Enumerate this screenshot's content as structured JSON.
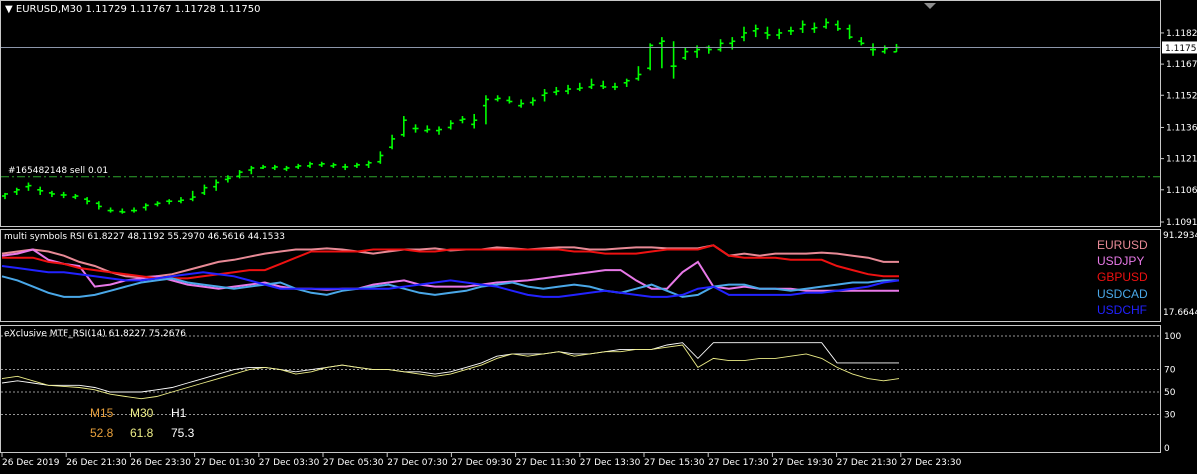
{
  "main_chart": {
    "header": "EURUSD,M30  1.11729 1.11767 1.11728 1.11750",
    "order_label": "#165482148 sell 0.01",
    "current_price": "1.11750",
    "price_ticks": [
      "1.11820",
      "1.11670",
      "1.11520",
      "1.11365",
      "1.11215",
      "1.11065",
      "1.10910"
    ],
    "price_range": [
      1.1091,
      1.1194
    ],
    "order_price": 1.11128,
    "bar_color": "#00ff00",
    "order_line_color": "#2ea52e",
    "bars": [
      [
        1.11035,
        1.1105,
        1.1102,
        1.11045
      ],
      [
        1.11055,
        1.11075,
        1.1104,
        1.11065
      ],
      [
        1.1108,
        1.111,
        1.1106,
        1.11085
      ],
      [
        1.11065,
        1.1108,
        1.1104,
        1.1106
      ],
      [
        1.1105,
        1.1106,
        1.1103,
        1.11045
      ],
      [
        1.1104,
        1.11055,
        1.11025,
        1.1104
      ],
      [
        1.1103,
        1.11045,
        1.1102,
        1.11035
      ],
      [
        1.1102,
        1.1103,
        1.10995,
        1.1101
      ],
      [
        1.11,
        1.1101,
        1.1097,
        1.10985
      ],
      [
        1.10965,
        1.1098,
        1.10955,
        1.10965
      ],
      [
        1.1096,
        1.10975,
        1.1095,
        1.10958
      ],
      [
        1.10965,
        1.1098,
        1.10955,
        1.10965
      ],
      [
        1.1098,
        1.11,
        1.10965,
        1.1099
      ],
      [
        1.10995,
        1.1101,
        1.10985,
        1.11
      ],
      [
        1.1101,
        1.1102,
        1.10995,
        1.1101
      ],
      [
        1.1101,
        1.1103,
        1.11,
        1.11015
      ],
      [
        1.1102,
        1.1106,
        1.1101,
        1.1103
      ],
      [
        1.1105,
        1.1109,
        1.1104,
        1.11075
      ],
      [
        1.1108,
        1.11115,
        1.1106,
        1.111
      ],
      [
        1.11115,
        1.11135,
        1.111,
        1.1112
      ],
      [
        1.1113,
        1.1116,
        1.1112,
        1.1115
      ],
      [
        1.1116,
        1.1118,
        1.1114,
        1.1117
      ],
      [
        1.1117,
        1.11185,
        1.11165,
        1.11175
      ],
      [
        1.1117,
        1.11185,
        1.1116,
        1.11175
      ],
      [
        1.11165,
        1.1118,
        1.11155,
        1.1117
      ],
      [
        1.11175,
        1.1119,
        1.11165,
        1.1118
      ],
      [
        1.1118,
        1.112,
        1.1117,
        1.1119
      ],
      [
        1.11185,
        1.112,
        1.11175,
        1.1119
      ],
      [
        1.1118,
        1.11195,
        1.1117,
        1.11185
      ],
      [
        1.11175,
        1.1119,
        1.1116,
        1.11175
      ],
      [
        1.1118,
        1.11195,
        1.1117,
        1.11185
      ],
      [
        1.11185,
        1.11205,
        1.1117,
        1.11195
      ],
      [
        1.112,
        1.1125,
        1.1119,
        1.1123
      ],
      [
        1.1127,
        1.1133,
        1.1126,
        1.1131
      ],
      [
        1.1133,
        1.1142,
        1.1132,
        1.114
      ],
      [
        1.1136,
        1.1138,
        1.1134,
        1.1136
      ],
      [
        1.1135,
        1.11375,
        1.1134,
        1.11355
      ],
      [
        1.1135,
        1.1137,
        1.1133,
        1.11355
      ],
      [
        1.11365,
        1.114,
        1.11355,
        1.11385
      ],
      [
        1.114,
        1.1142,
        1.11385,
        1.11405
      ],
      [
        1.1138,
        1.1143,
        1.1136,
        1.114
      ],
      [
        1.1147,
        1.1152,
        1.1138,
        1.115
      ],
      [
        1.115,
        1.1152,
        1.1149,
        1.11505
      ],
      [
        1.11495,
        1.11515,
        1.1148,
        1.1149
      ],
      [
        1.1147,
        1.115,
        1.1146,
        1.1148
      ],
      [
        1.11485,
        1.1151,
        1.1147,
        1.11495
      ],
      [
        1.1152,
        1.1155,
        1.1149,
        1.1153
      ],
      [
        1.11535,
        1.1156,
        1.1152,
        1.1154
      ],
      [
        1.1154,
        1.1157,
        1.11525,
        1.1155
      ],
      [
        1.1155,
        1.1158,
        1.1154,
        1.11555
      ],
      [
        1.1156,
        1.116,
        1.1155,
        1.1157
      ],
      [
        1.11565,
        1.1159,
        1.1155,
        1.1156
      ],
      [
        1.1156,
        1.1158,
        1.11545,
        1.1156
      ],
      [
        1.1158,
        1.116,
        1.1156,
        1.1159
      ],
      [
        1.116,
        1.1166,
        1.1159,
        1.1162
      ],
      [
        1.1165,
        1.1177,
        1.1164,
        1.1176
      ],
      [
        1.1177,
        1.118,
        1.1165,
        1.1178
      ],
      [
        1.1166,
        1.1178,
        1.116,
        1.1166
      ],
      [
        1.117,
        1.1175,
        1.1169,
        1.1173
      ],
      [
        1.1173,
        1.1176,
        1.117,
        1.1174
      ],
      [
        1.1175,
        1.1176,
        1.1172,
        1.1174
      ],
      [
        1.1174,
        1.1179,
        1.1173,
        1.1177
      ],
      [
        1.1177,
        1.118,
        1.1174,
        1.1178
      ],
      [
        1.118,
        1.1185,
        1.1178,
        1.1182
      ],
      [
        1.1183,
        1.1186,
        1.118,
        1.1184
      ],
      [
        1.1182,
        1.1185,
        1.1179,
        1.1181
      ],
      [
        1.1181,
        1.1184,
        1.1179,
        1.1182
      ],
      [
        1.1183,
        1.1185,
        1.1181,
        1.1183
      ],
      [
        1.1184,
        1.1188,
        1.1182,
        1.1186
      ],
      [
        1.1184,
        1.1187,
        1.1182,
        1.11845
      ],
      [
        1.1185,
        1.1189,
        1.1184,
        1.1187
      ],
      [
        1.1186,
        1.1188,
        1.1183,
        1.1184
      ],
      [
        1.1184,
        1.1186,
        1.1179,
        1.118
      ],
      [
        1.1178,
        1.118,
        1.1176,
        1.1177
      ],
      [
        1.1174,
        1.1177,
        1.1171,
        1.1174
      ],
      [
        1.1173,
        1.1176,
        1.1172,
        1.11745
      ],
      [
        1.11729,
        1.11767,
        1.11728,
        1.1175
      ]
    ]
  },
  "rsi_panel": {
    "header": "multi symbols RSI 61.8227 48.1192 55.2970 46.5616 44.1533",
    "scale_max": "91.2934",
    "scale_min": "17.6644",
    "range": [
      17.6644,
      91.2934
    ],
    "series": [
      {
        "name": "EURUSD",
        "color": "#e88a96",
        "values": [
          82,
          84,
          86,
          84,
          80,
          74,
          70,
          64,
          60,
          59,
          60,
          62,
          66,
          70,
          74,
          76,
          79,
          82,
          84,
          86,
          86,
          87,
          86,
          84,
          82,
          84,
          86,
          86,
          87,
          85,
          86,
          86,
          88,
          87,
          86,
          87,
          88,
          88,
          86,
          86,
          87,
          88,
          88,
          87,
          87,
          87,
          90,
          80,
          82,
          80,
          82,
          82,
          82,
          83,
          82,
          80,
          78,
          74,
          74
        ]
      },
      {
        "name": "USDJPY",
        "color": "#e879e8",
        "values": [
          80,
          82,
          86,
          76,
          72,
          70,
          50,
          52,
          56,
          58,
          60,
          56,
          52,
          50,
          48,
          50,
          52,
          54,
          50,
          48,
          48,
          47,
          48,
          48,
          52,
          54,
          56,
          52,
          50,
          50,
          50,
          52,
          54,
          55,
          56,
          58,
          60,
          62,
          64,
          66,
          66,
          56,
          48,
          48,
          64,
          74,
          50,
          48,
          50,
          48,
          48,
          48,
          46,
          46,
          46,
          46,
          46,
          46,
          46
        ]
      },
      {
        "name": "GBPUSD",
        "color": "#ee1111",
        "values": [
          78,
          78,
          78,
          74,
          72,
          68,
          66,
          64,
          62,
          60,
          58,
          58,
          58,
          60,
          62,
          64,
          66,
          66,
          72,
          78,
          84,
          84,
          84,
          84,
          86,
          86,
          86,
          84,
          84,
          86,
          86,
          86,
          86,
          86,
          86,
          86,
          86,
          84,
          84,
          82,
          82,
          82,
          84,
          86,
          86,
          86,
          90,
          80,
          78,
          78,
          78,
          76,
          76,
          76,
          70,
          66,
          62,
          60,
          60
        ]
      },
      {
        "name": "USDCAD",
        "color": "#4aa8e8",
        "values": [
          60,
          56,
          50,
          44,
          40,
          40,
          42,
          46,
          50,
          54,
          56,
          58,
          54,
          52,
          50,
          48,
          50,
          52,
          54,
          48,
          44,
          42,
          46,
          48,
          50,
          52,
          48,
          44,
          42,
          44,
          46,
          50,
          52,
          54,
          50,
          48,
          50,
          52,
          50,
          46,
          44,
          48,
          52,
          46,
          40,
          42,
          50,
          52,
          52,
          48,
          48,
          46,
          48,
          50,
          52,
          54,
          54,
          56,
          56
        ]
      },
      {
        "name": "USDCHF",
        "color": "#2222ff",
        "values": [
          70,
          68,
          66,
          64,
          64,
          62,
          60,
          58,
          56,
          56,
          58,
          60,
          62,
          64,
          62,
          60,
          56,
          52,
          48,
          48,
          48,
          48,
          48,
          48,
          48,
          48,
          50,
          52,
          54,
          56,
          54,
          52,
          50,
          46,
          42,
          40,
          40,
          42,
          44,
          46,
          44,
          42,
          40,
          40,
          42,
          48,
          50,
          42,
          42,
          42,
          42,
          42,
          44,
          44,
          46,
          48,
          50,
          54,
          56
        ]
      }
    ]
  },
  "mtf_panel": {
    "header": "eXclusive MTF_RSI(14) 61.8227 75.2676",
    "range": [
      0,
      100
    ],
    "scale_labels": [
      "100",
      "70",
      "50",
      "30",
      "0"
    ],
    "levels": [
      100,
      70,
      50,
      30
    ],
    "level_color": "#c8c8c8",
    "tf_labels": [
      {
        "tf": "M15",
        "value": "52.8",
        "color": "#e8a03c"
      },
      {
        "tf": "M30",
        "value": "61.8",
        "color": "#eeee88"
      },
      {
        "tf": "H1",
        "value": "75.3",
        "color": "#ffffff"
      }
    ],
    "m30_values": [
      62,
      64,
      60,
      56,
      55,
      54,
      52,
      48,
      46,
      44,
      46,
      50,
      54,
      58,
      62,
      66,
      70,
      72,
      70,
      66,
      68,
      72,
      74,
      72,
      70,
      70,
      68,
      66,
      64,
      66,
      70,
      74,
      80,
      84,
      82,
      84,
      86,
      82,
      84,
      86,
      86,
      88,
      88,
      90,
      92,
      72,
      80,
      78,
      78,
      80,
      80,
      82,
      84,
      80,
      72,
      66,
      62,
      60,
      62
    ],
    "h1_values": [
      58,
      60,
      58,
      56,
      56,
      56,
      54,
      50,
      50,
      50,
      52,
      54,
      58,
      62,
      66,
      70,
      72,
      72,
      70,
      68,
      70,
      72,
      74,
      72,
      70,
      70,
      68,
      68,
      66,
      68,
      72,
      76,
      82,
      84,
      84,
      84,
      86,
      84,
      84,
      86,
      88,
      88,
      88,
      92,
      94,
      80,
      94,
      94,
      94,
      94,
      94,
      94,
      94,
      94,
      76,
      76,
      76,
      76,
      76
    ]
  },
  "time_axis": [
    "26 Dec 2019",
    "26 Dec 21:30",
    "26 Dec 23:30",
    "27 Dec 01:30",
    "27 Dec 03:30",
    "27 Dec 05:30",
    "27 Dec 07:30",
    "27 Dec 09:30",
    "27 Dec 11:30",
    "27 Dec 13:30",
    "27 Dec 15:30",
    "27 Dec 17:30",
    "27 Dec 19:30",
    "27 Dec 21:30",
    "27 Dec 23:30"
  ]
}
